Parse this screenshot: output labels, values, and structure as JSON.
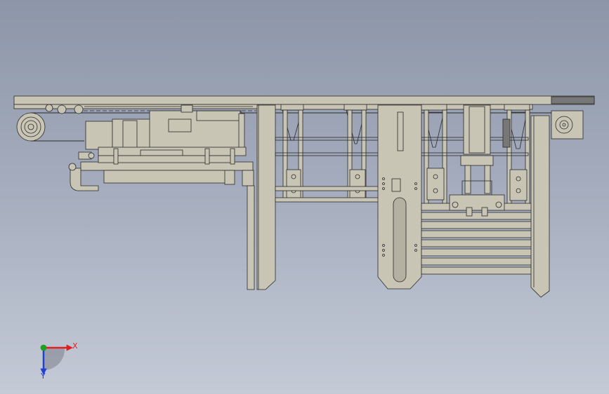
{
  "viewport": {
    "background_top": "#8d96a8",
    "background_bottom": "#c4cad6"
  },
  "model": {
    "view": "front",
    "fill_color": "#c9c5b5",
    "line_color": "#2a2a2a",
    "dark_part_color": "#777777"
  },
  "triad": {
    "x_label": "X",
    "y_label": "Y",
    "x_color": "#e02020",
    "y_color": "#2040d0",
    "origin_color": "#20a020"
  }
}
